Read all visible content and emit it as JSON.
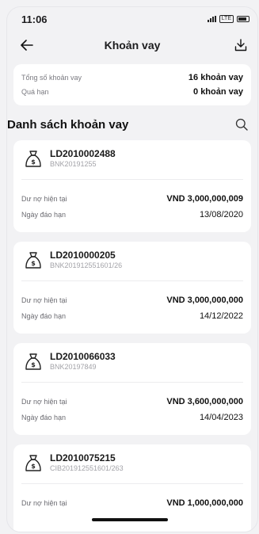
{
  "status_bar": {
    "time": "11:06",
    "network": "LTE"
  },
  "header": {
    "title": "Khoản vay",
    "back_icon": "arrow-left-icon",
    "download_icon": "download-icon"
  },
  "summary": {
    "total_label": "Tổng số khoản vay",
    "total_value": "16 khoản vay",
    "overdue_label": "Quá hạn",
    "overdue_value": "0 khoản vay"
  },
  "list": {
    "title": "Danh sách khoản vay",
    "search_icon": "search-icon",
    "items": [
      {
        "id": "LD2010002488",
        "ref": "BNK20191255",
        "balance_label": "Dư nợ hiện tại",
        "balance": "VND 3,000,000,009",
        "date_label": "Ngày đáo hạn",
        "date": "13/08/2020"
      },
      {
        "id": "LD2010000205",
        "ref": "BNK201912551601/26",
        "balance_label": "Dư nợ hiện tại",
        "balance": "VND 3,000,000,000",
        "date_label": "Ngày đáo hạn",
        "date": "14/12/2022"
      },
      {
        "id": "LD2010066033",
        "ref": "BNK20197849",
        "balance_label": "Dư nợ hiện tại",
        "balance": "VND 3,600,000,000",
        "date_label": "Ngày đáo hạn",
        "date": "14/04/2023"
      },
      {
        "id": "LD2010075215",
        "ref": "CIB201912551601/263",
        "balance_label": "Dư nợ hiện tại",
        "balance": "VND 1,000,000,000",
        "date_label": "",
        "date": ""
      }
    ]
  }
}
